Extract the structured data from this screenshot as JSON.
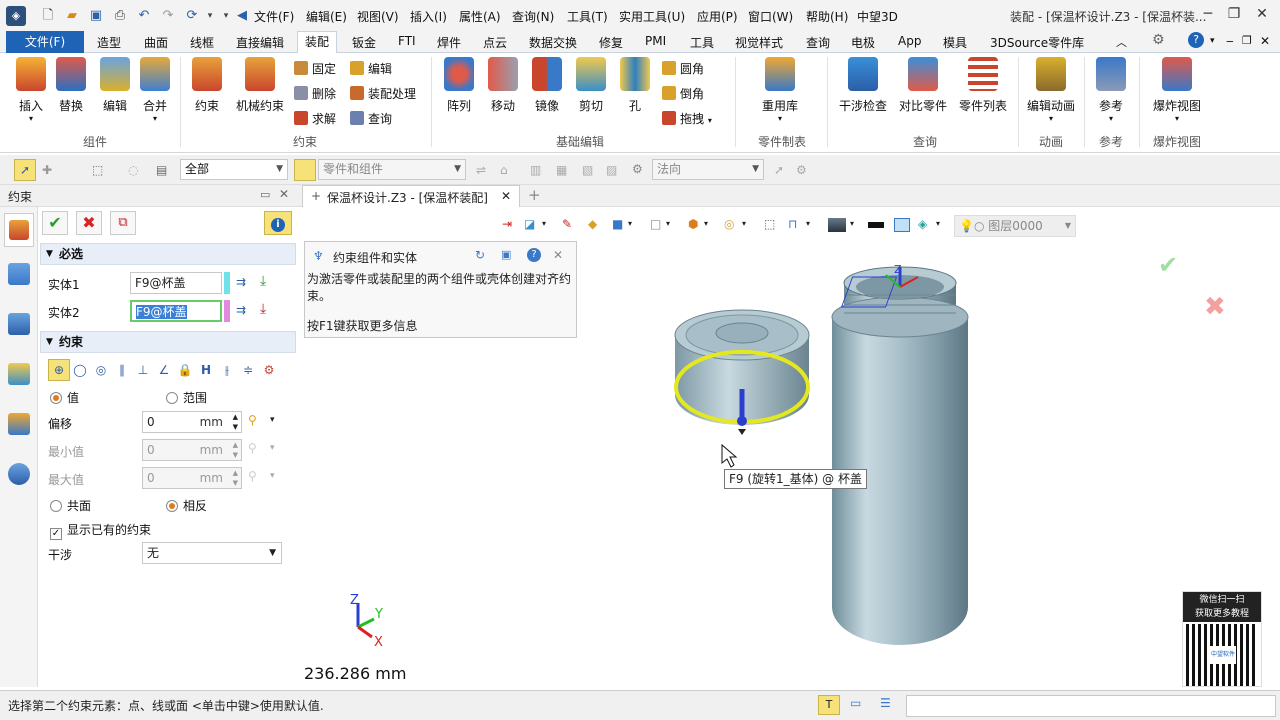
{
  "title_bar": {
    "menus": [
      "文件(F)",
      "编辑(E)",
      "视图(V)",
      "插入(I)",
      "属性(A)",
      "查询(N)",
      "工具(T)",
      "实用工具(U)",
      "应用(P)",
      "窗口(W)",
      "帮助(H)"
    ],
    "app_name": "中望3D",
    "window_title": "装配 - [保温杯设计.Z3 - [保温杯装..."
  },
  "ribbon_tabs": {
    "file": "文件(F)",
    "tabs": [
      "造型",
      "曲面",
      "线框",
      "直接编辑",
      "装配",
      "钣金",
      "FTI",
      "焊件",
      "点云",
      "数据交换",
      "修复",
      "PMI",
      "工具",
      "视觉样式",
      "查询",
      "电极",
      "App",
      "模具",
      "3DSource零件库"
    ],
    "active": "装配"
  },
  "ribbon": {
    "component_buttons": [
      "插入",
      "替换",
      "编辑",
      "合并"
    ],
    "constraint_buttons": [
      "约束",
      "机械约束"
    ],
    "constraint_small": [
      "固定",
      "删除",
      "求解",
      "编辑",
      "装配处理",
      "查询"
    ],
    "basic_buttons": [
      "阵列",
      "移动",
      "镜像",
      "剪切",
      "孔"
    ],
    "basic_small": [
      "圆角",
      "倒角",
      "拖拽"
    ],
    "parts_buttons": [
      "重用库"
    ],
    "query_buttons": [
      "干涉检查",
      "对比零件",
      "零件列表"
    ],
    "anim_buttons": [
      "编辑动画"
    ],
    "ref_buttons": [
      "参考"
    ],
    "explode_buttons": [
      "爆炸视图"
    ],
    "groups": [
      "组件",
      "约束",
      "基础编辑",
      "零件制表",
      "查询",
      "动画",
      "参考",
      "爆炸视图"
    ]
  },
  "toolbar2": {
    "filter_value": "全部",
    "select_value": "零件和组件",
    "direction_value": "法向"
  },
  "panel": {
    "title": "约束",
    "required_section": "必选",
    "entity1_label": "实体1",
    "entity1_value": "F9@杯盖",
    "entity2_label": "实体2",
    "entity2_value": "F9@杯盖",
    "constraint_section": "约束",
    "radio_value": "值",
    "radio_range": "范围",
    "offset_label": "偏移",
    "offset_value": "0",
    "offset_unit": "mm",
    "min_label": "最小值",
    "min_value": "0",
    "min_unit": "mm",
    "max_label": "最大值",
    "max_value": "0",
    "max_unit": "mm",
    "coplanar": "共面",
    "opposite": "相反",
    "show_existing": "显示已有的约束",
    "interference_label": "干涉",
    "interference_value": "无"
  },
  "doc_tab": {
    "label": "保温杯设计.Z3 - [保温杯装配]"
  },
  "viewport": {
    "layer_label": "图层0000",
    "tooltip_title": "约束组件和实体",
    "tooltip_body": "为激活零件或装配里的两个组件或壳体创建对齐约束。",
    "tooltip_help": "按F1键获取更多信息",
    "hover_label": "F9 (旋转1_基体) @ 杯盖",
    "distance": "236.286 mm",
    "axis_x": "X",
    "axis_y": "Y",
    "axis_z": "Z",
    "qr_line1": "微信扫一扫",
    "qr_line2": "获取更多教程",
    "qr_center": "中望软件"
  },
  "status_bar": {
    "message": "选择第二个约束元素：点、线或面  <单击中键>使用默认值."
  },
  "colors": {
    "accent": "#1e63b6",
    "selection": "#e4e81e",
    "panel_section": "#e8eef7"
  }
}
